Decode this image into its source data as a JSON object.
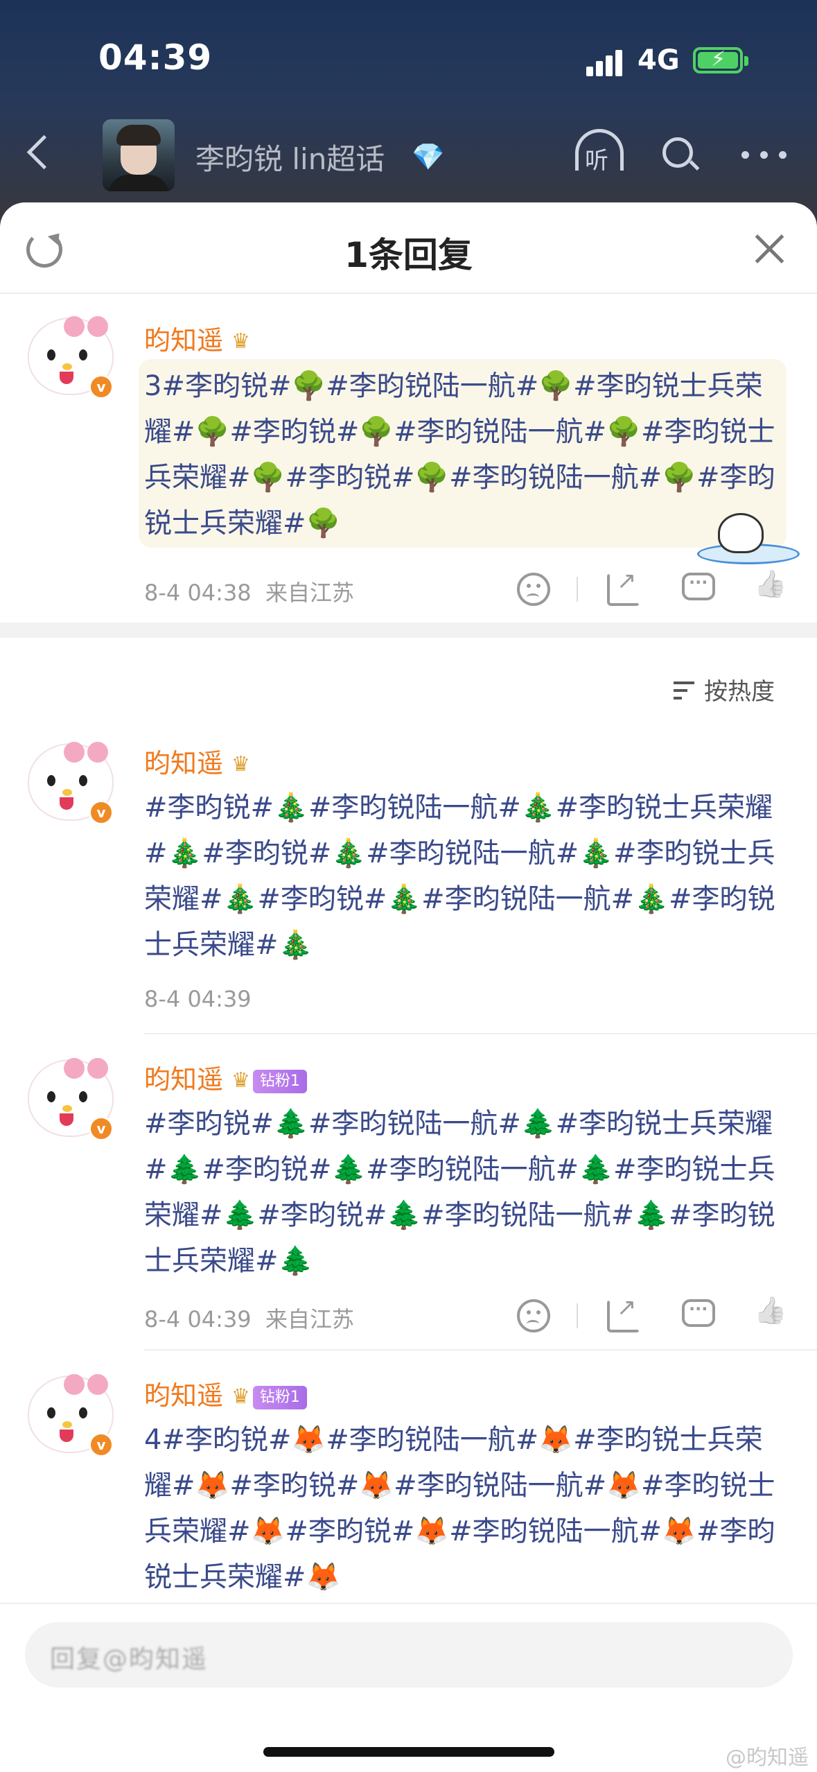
{
  "status": {
    "time": "04:39",
    "network": "4G"
  },
  "header": {
    "topic_title": "李昀锐 lin超话"
  },
  "sheet": {
    "title": "1条回复",
    "sort_label": "按热度"
  },
  "comments": [
    {
      "username": "昀知遥",
      "crown_level": "6",
      "text": "3#李昀锐#🌳#李昀锐陆一航#🌳#李昀锐士兵荣耀#🌳#李昀锐#🌳#李昀锐陆一航#🌳#李昀锐士兵荣耀#🌳#李昀锐#🌳#李昀锐陆一航#🌳#李昀锐士兵荣耀#🌳",
      "time": "8-4 04:38",
      "location": "来自江苏"
    },
    {
      "username": "昀知遥",
      "crown_level": "6",
      "text": "#李昀锐#🎄#李昀锐陆一航#🎄#李昀锐士兵荣耀#🎄#李昀锐#🎄#李昀锐陆一航#🎄#李昀锐士兵荣耀#🎄#李昀锐#🎄#李昀锐陆一航#🎄#李昀锐士兵荣耀#🎄",
      "time": "8-4 04:39",
      "location": ""
    },
    {
      "username": "昀知遥",
      "crown_level": "6",
      "fan_badge": "钻粉1",
      "text": "#李昀锐#🌲#李昀锐陆一航#🌲#李昀锐士兵荣耀#🌲#李昀锐#🌲#李昀锐陆一航#🌲#李昀锐士兵荣耀#🌲#李昀锐#🌲#李昀锐陆一航#🌲#李昀锐士兵荣耀#🌲",
      "time": "8-4 04:39",
      "location": "来自江苏"
    },
    {
      "username": "昀知遥",
      "crown_level": "6",
      "fan_badge": "钻粉1",
      "text": "4#李昀锐#🦊#李昀锐陆一航#🦊#李昀锐士兵荣耀#🦊#李昀锐#🦊#李昀锐陆一航#🦊#李昀锐士兵荣耀#🦊#李昀锐#🦊#李昀锐陆一航#🦊#李昀锐士兵荣耀#🦊"
    }
  ],
  "input": {
    "placeholder": "回复@昀知遥"
  },
  "watermark": "@昀知遥",
  "icons": [
    "back-icon",
    "gem-icon",
    "listen-icon",
    "search-icon",
    "more-icon",
    "refresh-icon",
    "close-icon",
    "dislike-icon",
    "share-icon",
    "reply-icon",
    "like-icon",
    "sort-icon"
  ],
  "colors": {
    "username": "#f07a1e",
    "hashtag": "#3a4a8a",
    "accent_orange": "#f08a24",
    "fan_badge": "#b07ae8"
  }
}
